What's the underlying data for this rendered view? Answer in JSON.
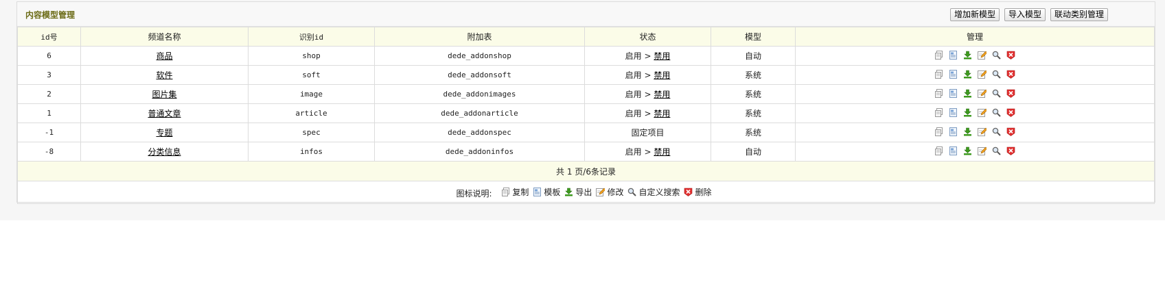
{
  "header": {
    "title": "内容模型管理",
    "buttons": [
      "增加新模型",
      "导入模型",
      "联动类别管理"
    ]
  },
  "table": {
    "columns": [
      "id号",
      "频道名称",
      "识别id",
      "附加表",
      "状态",
      "模型",
      "管理"
    ],
    "rows": [
      {
        "id": "6",
        "name": "商品",
        "nid": "shop",
        "addtable": "dede_addonshop",
        "status_on": "启用",
        "status_sep": ">",
        "status_link": "禁用",
        "model": "自动"
      },
      {
        "id": "3",
        "name": "软件",
        "nid": "soft",
        "addtable": "dede_addonsoft",
        "status_on": "启用",
        "status_sep": ">",
        "status_link": "禁用",
        "model": "系统"
      },
      {
        "id": "2",
        "name": "图片集",
        "nid": "image",
        "addtable": "dede_addonimages",
        "status_on": "启用",
        "status_sep": ">",
        "status_link": "禁用",
        "model": "系统"
      },
      {
        "id": "1",
        "name": "普通文章",
        "nid": "article",
        "addtable": "dede_addonarticle",
        "status_on": "启用",
        "status_sep": ">",
        "status_link": "禁用",
        "model": "系统"
      },
      {
        "id": "-1",
        "name": "专题",
        "nid": "spec",
        "addtable": "dede_addonspec",
        "status_fixed": "固定项目",
        "model": "系统"
      },
      {
        "id": "-8",
        "name": "分类信息",
        "nid": "infos",
        "addtable": "dede_addoninfos",
        "status_on": "启用",
        "status_sep": ">",
        "status_link": "禁用",
        "model": "自动"
      }
    ],
    "pager": "共 1 页/6条记录"
  },
  "legend": {
    "label": "图标说明:",
    "items": [
      {
        "icon": "copy-icon",
        "label": "复制"
      },
      {
        "icon": "template-icon",
        "label": "模板"
      },
      {
        "icon": "export-icon",
        "label": "导出"
      },
      {
        "icon": "edit-icon",
        "label": "修改"
      },
      {
        "icon": "search-icon",
        "label": "自定义搜索"
      },
      {
        "icon": "delete-icon",
        "label": "删除"
      }
    ]
  },
  "colors": {
    "title": "#6b6b16",
    "header_bg": "#fbfce8",
    "delete": "#e23030",
    "export": "#3d9a1e"
  }
}
